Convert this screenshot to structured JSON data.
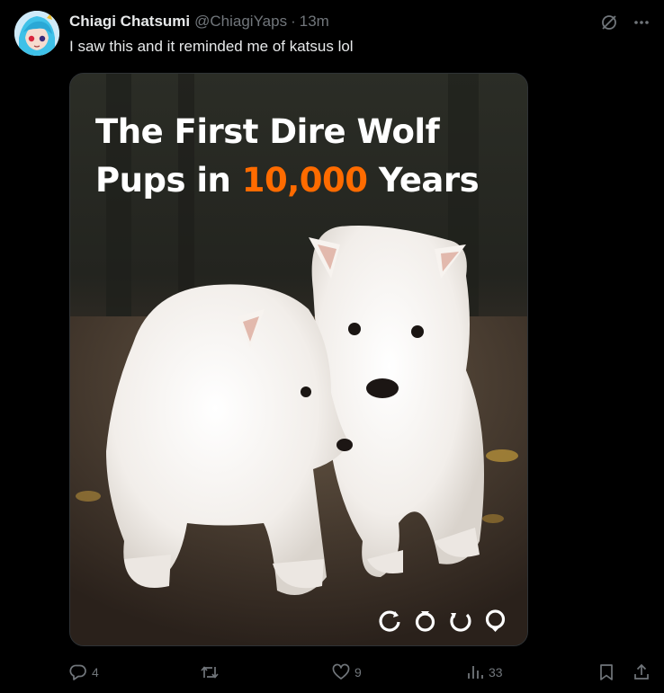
{
  "tweet": {
    "display_name": "Chiagi Chatsumi",
    "handle": "@ChiagiYaps",
    "separator": "·",
    "time": "13m",
    "text": "I saw this and it reminded me of katsus lol"
  },
  "media": {
    "title_line1": "The First Dire Wolf",
    "title_line2_prefix": "Pups in ",
    "title_line2_accent": "10,000",
    "title_line2_suffix": " Years",
    "accent_color": "#ff6b00"
  },
  "actions": {
    "reply_count": "4",
    "retweet_count": "",
    "like_count": "9",
    "views_count": "33"
  },
  "icons": {
    "grok": "grok-icon",
    "more": "more-icon",
    "reply": "reply-icon",
    "retweet": "retweet-icon",
    "like": "heart-icon",
    "views": "analytics-icon",
    "bookmark": "bookmark-icon",
    "share": "share-icon"
  },
  "colors": {
    "background": "#000000",
    "text_primary": "#e7e9ea",
    "text_secondary": "#71767b",
    "border": "#2f3336"
  }
}
